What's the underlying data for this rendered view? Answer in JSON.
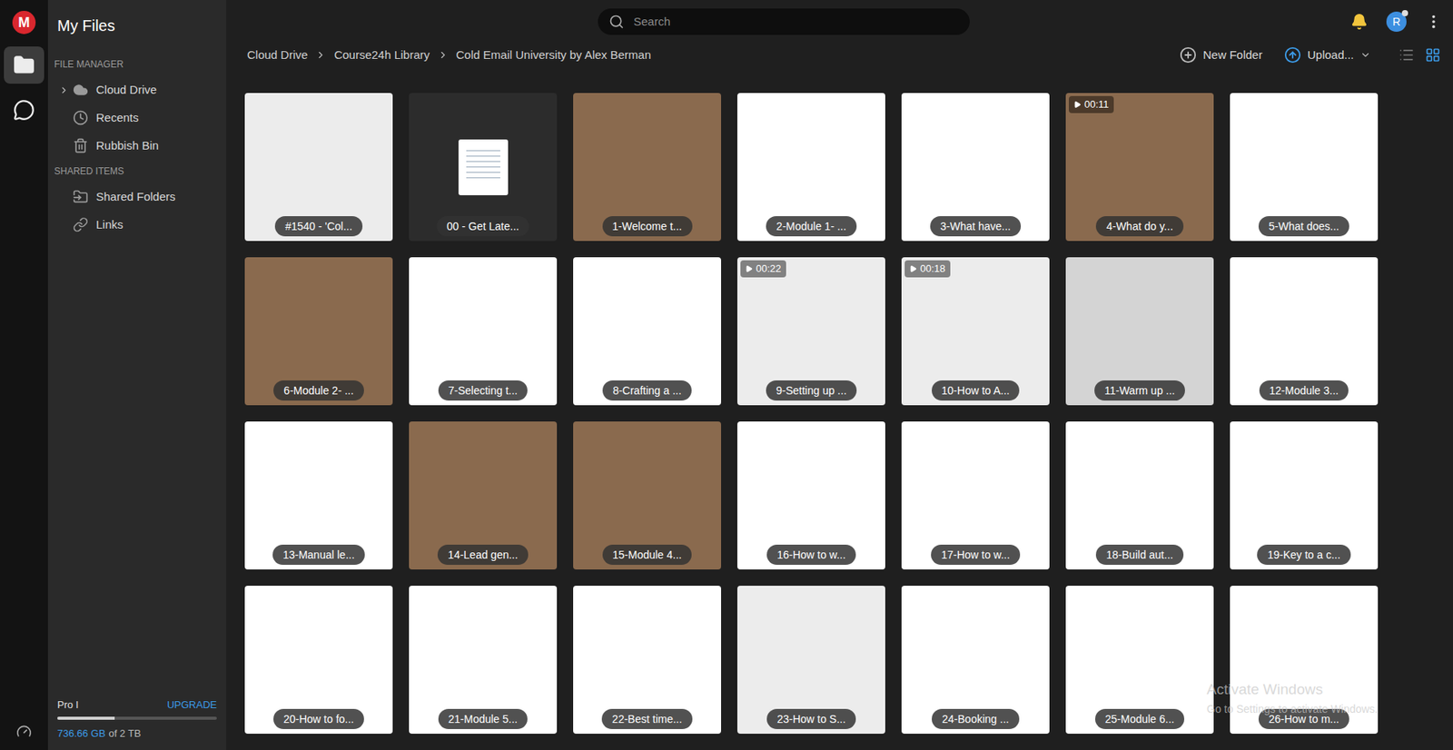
{
  "app": {
    "logo": "M",
    "title": "My Files"
  },
  "rail": [
    {
      "kind": "files",
      "selected": true
    },
    {
      "kind": "chat",
      "selected": false
    }
  ],
  "sidebar": {
    "sections": [
      {
        "heading": "FILE MANAGER",
        "items": [
          {
            "kind": "cloud",
            "label": "Cloud Drive",
            "expandable": true,
            "selected": false
          },
          {
            "kind": "recents",
            "label": "Recents",
            "expandable": false,
            "selected": false
          },
          {
            "kind": "bin",
            "label": "Rubbish Bin",
            "expandable": false,
            "selected": false
          }
        ]
      },
      {
        "heading": "SHARED ITEMS",
        "items": [
          {
            "kind": "shared",
            "label": "Shared Folders",
            "expandable": false,
            "selected": false
          },
          {
            "kind": "links",
            "label": "Links",
            "expandable": false,
            "selected": false
          }
        ]
      }
    ]
  },
  "storage": {
    "plan": "Pro I",
    "upgrade": "UPGRADE",
    "used": "736.66 GB",
    "total": "of 2 TB",
    "level": 0.36
  },
  "search": {
    "placeholder": "Search"
  },
  "account": {
    "initial": "R"
  },
  "breadcrumb": [
    "Cloud Drive",
    "Course24h Library",
    "Cold Email University by Alex Berman"
  ],
  "actions": {
    "new_folder": "New Folder",
    "upload": "Upload..."
  },
  "view": {
    "list": false,
    "grid": true
  },
  "files": [
    {
      "name": "#1540 - 'Col...",
      "kind": "screen",
      "duration": ""
    },
    {
      "name": "00 - Get Late...",
      "kind": "document",
      "duration": ""
    },
    {
      "name": "1-Welcome t...",
      "kind": "photo",
      "duration": ""
    },
    {
      "name": "2-Module 1- ...",
      "kind": "slide",
      "duration": ""
    },
    {
      "name": "3-What have...",
      "kind": "slide",
      "duration": ""
    },
    {
      "name": "4-What do y...",
      "kind": "photo",
      "duration": "00:11"
    },
    {
      "name": "5-What does...",
      "kind": "slide",
      "duration": ""
    },
    {
      "name": "6-Module 2- ...",
      "kind": "photo",
      "duration": ""
    },
    {
      "name": "7-Selecting t...",
      "kind": "slide",
      "duration": ""
    },
    {
      "name": "8-Crafting a ...",
      "kind": "slide",
      "duration": ""
    },
    {
      "name": "9-Setting up ...",
      "kind": "screen",
      "duration": "00:22"
    },
    {
      "name": "10-How to A...",
      "kind": "screen",
      "duration": "00:18"
    },
    {
      "name": "11-Warm up ...",
      "kind": "grey",
      "duration": ""
    },
    {
      "name": "12-Module 3...",
      "kind": "slide",
      "duration": ""
    },
    {
      "name": "13-Manual le...",
      "kind": "slide",
      "duration": ""
    },
    {
      "name": "14-Lead gen...",
      "kind": "photo",
      "duration": ""
    },
    {
      "name": "15-Module 4...",
      "kind": "photo",
      "duration": ""
    },
    {
      "name": "16-How to w...",
      "kind": "slide",
      "duration": ""
    },
    {
      "name": "17-How to w...",
      "kind": "slide",
      "duration": ""
    },
    {
      "name": "18-Build aut...",
      "kind": "slide",
      "duration": ""
    },
    {
      "name": "19-Key to a c...",
      "kind": "slide",
      "duration": ""
    },
    {
      "name": "20-How to fo...",
      "kind": "slide",
      "duration": ""
    },
    {
      "name": "21-Module 5...",
      "kind": "slide",
      "duration": ""
    },
    {
      "name": "22-Best time...",
      "kind": "slide",
      "duration": ""
    },
    {
      "name": "23-How to S...",
      "kind": "screen",
      "duration": ""
    },
    {
      "name": "24-Booking ...",
      "kind": "slide",
      "duration": ""
    },
    {
      "name": "25-Module 6...",
      "kind": "slide",
      "duration": ""
    },
    {
      "name": "26-How to m...",
      "kind": "slide",
      "duration": ""
    }
  ],
  "watermark": {
    "title": "Activate Windows",
    "subtitle": "Go to Settings to activate Windows."
  }
}
